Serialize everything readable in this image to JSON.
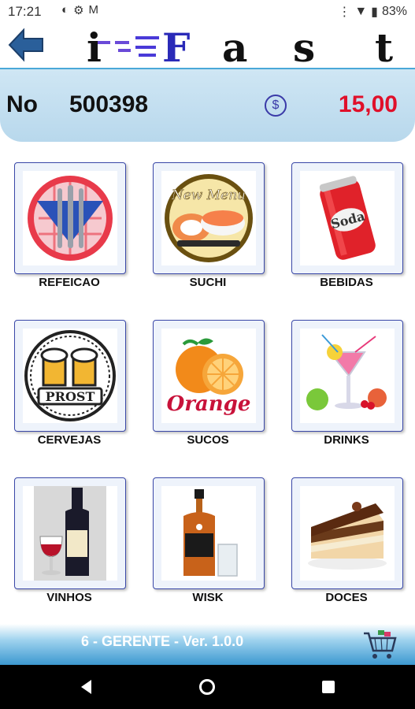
{
  "status": {
    "time": "17:21",
    "battery": "83%"
  },
  "app": {
    "logo_text": "i-Fast"
  },
  "order": {
    "label": "No",
    "number": "500398",
    "total": "15,00",
    "currency_symbol": "$"
  },
  "categories": [
    {
      "label": "REFEICAO",
      "icon": "plate-cutlery-icon"
    },
    {
      "label": "SUCHI",
      "icon": "sushi-icon"
    },
    {
      "label": "BEBIDAS",
      "icon": "soda-can-icon"
    },
    {
      "label": "CERVEJAS",
      "icon": "beer-mugs-icon"
    },
    {
      "label": "SUCOS",
      "icon": "orange-icon"
    },
    {
      "label": "DRINKS",
      "icon": "cocktail-icon"
    },
    {
      "label": "VINHOS",
      "icon": "wine-bottle-icon"
    },
    {
      "label": "WISK",
      "icon": "whisky-bottle-icon"
    },
    {
      "label": "DOCES",
      "icon": "cake-slice-icon"
    }
  ],
  "images": {
    "new_menu": "New Menu",
    "soda": "Soda",
    "prost": "PROST",
    "orange": "Orange"
  },
  "footer": {
    "user_version": "6 - GERENTE -   Ver. 1.0.0"
  },
  "colors": {
    "accent_blue": "#3a48a8",
    "total_red": "#e0102a",
    "header_bg": "#cfe6f4"
  }
}
